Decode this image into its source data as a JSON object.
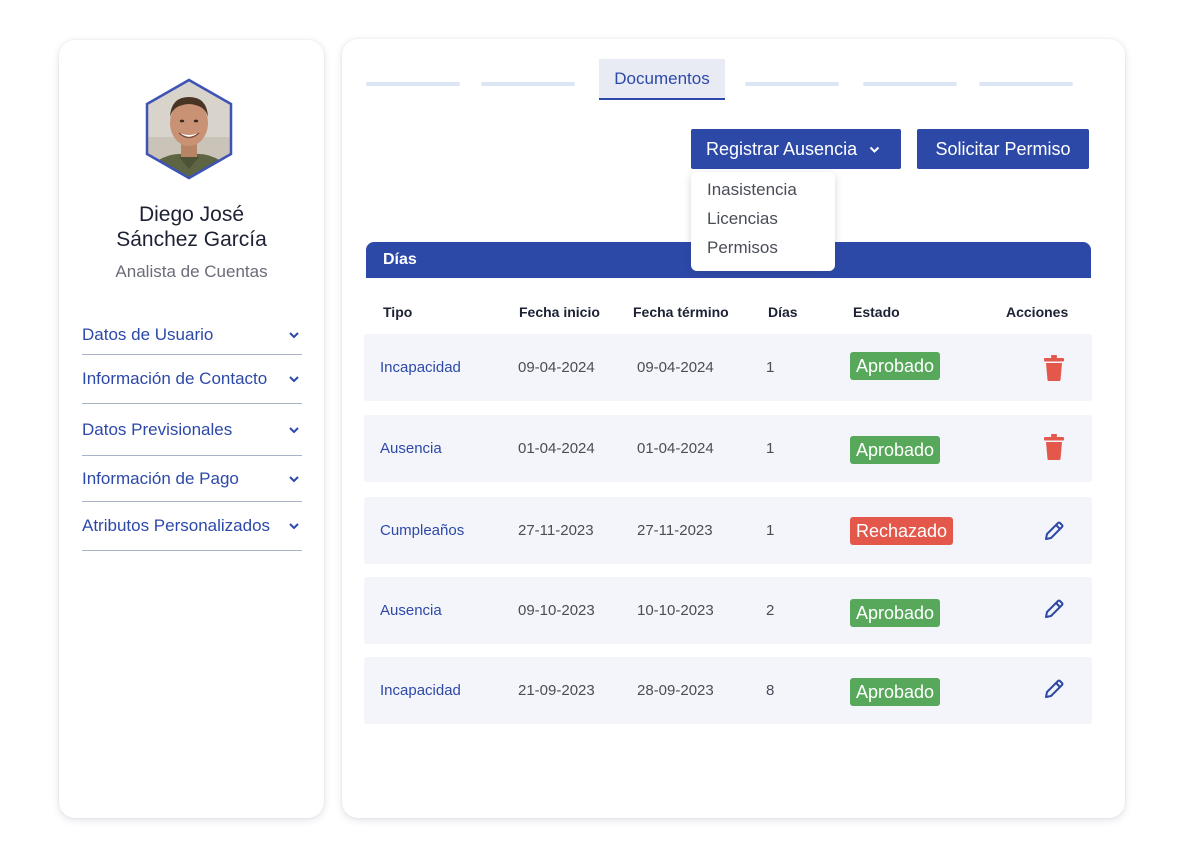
{
  "profile": {
    "name_line1": "Diego José",
    "name_line2": "Sánchez García",
    "role": "Analista de Cuentas",
    "accordion": [
      {
        "label": "Datos de Usuario"
      },
      {
        "label": "Información de Contacto"
      },
      {
        "label": "Datos Previsionales"
      },
      {
        "label": "Información de Pago"
      },
      {
        "label": "Atributos Personalizados"
      }
    ]
  },
  "tabs": {
    "active_label": "Documentos"
  },
  "actions": {
    "registrar_label": "Registrar Ausencia",
    "solicitar_label": "Solicitar Permiso",
    "dropdown": [
      "Inasistencia",
      "Licencias",
      "Permisos"
    ]
  },
  "table": {
    "title": "Días",
    "columns": [
      "Tipo",
      "Fecha inicio",
      "Fecha término",
      "Días",
      "Estado",
      "Acciones"
    ],
    "rows": [
      {
        "tipo": "Incapacidad",
        "inicio": "09-04-2024",
        "termino": "09-04-2024",
        "dias": "1",
        "estado": "Aprobado",
        "action_icon": "trash-icon"
      },
      {
        "tipo": "Ausencia",
        "inicio": "01-04-2024",
        "termino": "01-04-2024",
        "dias": "1",
        "estado": "Aprobado",
        "action_icon": "trash-icon"
      },
      {
        "tipo": "Cumpleaños",
        "inicio": "27-11-2023",
        "termino": "27-11-2023",
        "dias": "1",
        "estado": "Rechazado",
        "action_icon": "pencil-icon"
      },
      {
        "tipo": "Ausencia",
        "inicio": "09-10-2023",
        "termino": "10-10-2023",
        "dias": "2",
        "estado": "Aprobado",
        "action_icon": "pencil-icon"
      },
      {
        "tipo": "Incapacidad",
        "inicio": "21-09-2023",
        "termino": "28-09-2023",
        "dias": "8",
        "estado": "Aprobado",
        "action_icon": "pencil-icon"
      }
    ]
  },
  "colors": {
    "primary": "#2d49a8",
    "approved": "#58a85c",
    "rejected": "#e4584c",
    "delete": "#e4584c",
    "row_bg": "#f4f5fa"
  }
}
